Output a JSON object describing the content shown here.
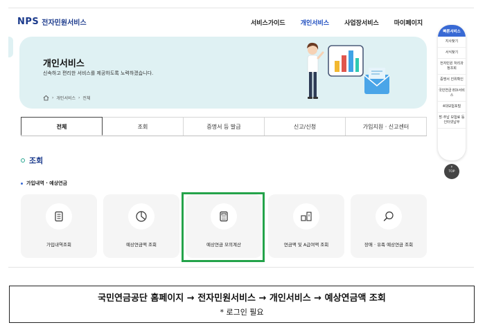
{
  "header": {
    "logo_mark": "NPS",
    "logo_text": "전자민원서비스",
    "nav": [
      "서비스가이드",
      "개인서비스",
      "사업장서비스",
      "마이페이지"
    ],
    "active_nav": "개인서비스"
  },
  "quick_menu": {
    "title": "빠른서비스",
    "items": [
      "지사찾기",
      "서식찾기",
      "전자민원 처리과정조회",
      "증명서 진위확인",
      "국민연금 EDI서비스",
      "4대보험포털",
      "방·추납 보험료 등 인터넷납부"
    ],
    "top_label": "TOP"
  },
  "banner": {
    "title": "개인서비스",
    "subtitle": "신속하고 편리한 서비스를 제공하도록 노력하겠습니다.",
    "breadcrumb": [
      "개인서비스",
      "전체"
    ]
  },
  "tabs": [
    "전체",
    "조회",
    "증명서 등 발급",
    "신고/신청",
    "가입지원 · 신고센터"
  ],
  "active_tab": "전체",
  "section": {
    "title": "조회",
    "subtitle": "가입내역 · 예상연금"
  },
  "cards": [
    {
      "label": "가입내역조회",
      "icon": "document-list-icon"
    },
    {
      "label": "예상연금액 조회",
      "icon": "pie-chart-icon"
    },
    {
      "label": "예상연금 모의계산",
      "icon": "calculator-icon"
    },
    {
      "label": "연금액 및 A급여액 조회",
      "icon": "bar-compare-icon"
    },
    {
      "label": "장애 · 유족 예상연금 조회",
      "icon": "magnifier-icon"
    }
  ],
  "highlighted_card": "예상연금 모의계산",
  "caption": {
    "line1": "국민연금공단 홈페이지 → 전자민원서비스 → 개인서비스 → 예상연금액 조회",
    "line2": "* 로그인 필요"
  },
  "colors": {
    "brand": "#1b3a8c",
    "accent": "#3869d4",
    "banner_bg": "#dff1f3",
    "highlight": "#24a34a"
  }
}
